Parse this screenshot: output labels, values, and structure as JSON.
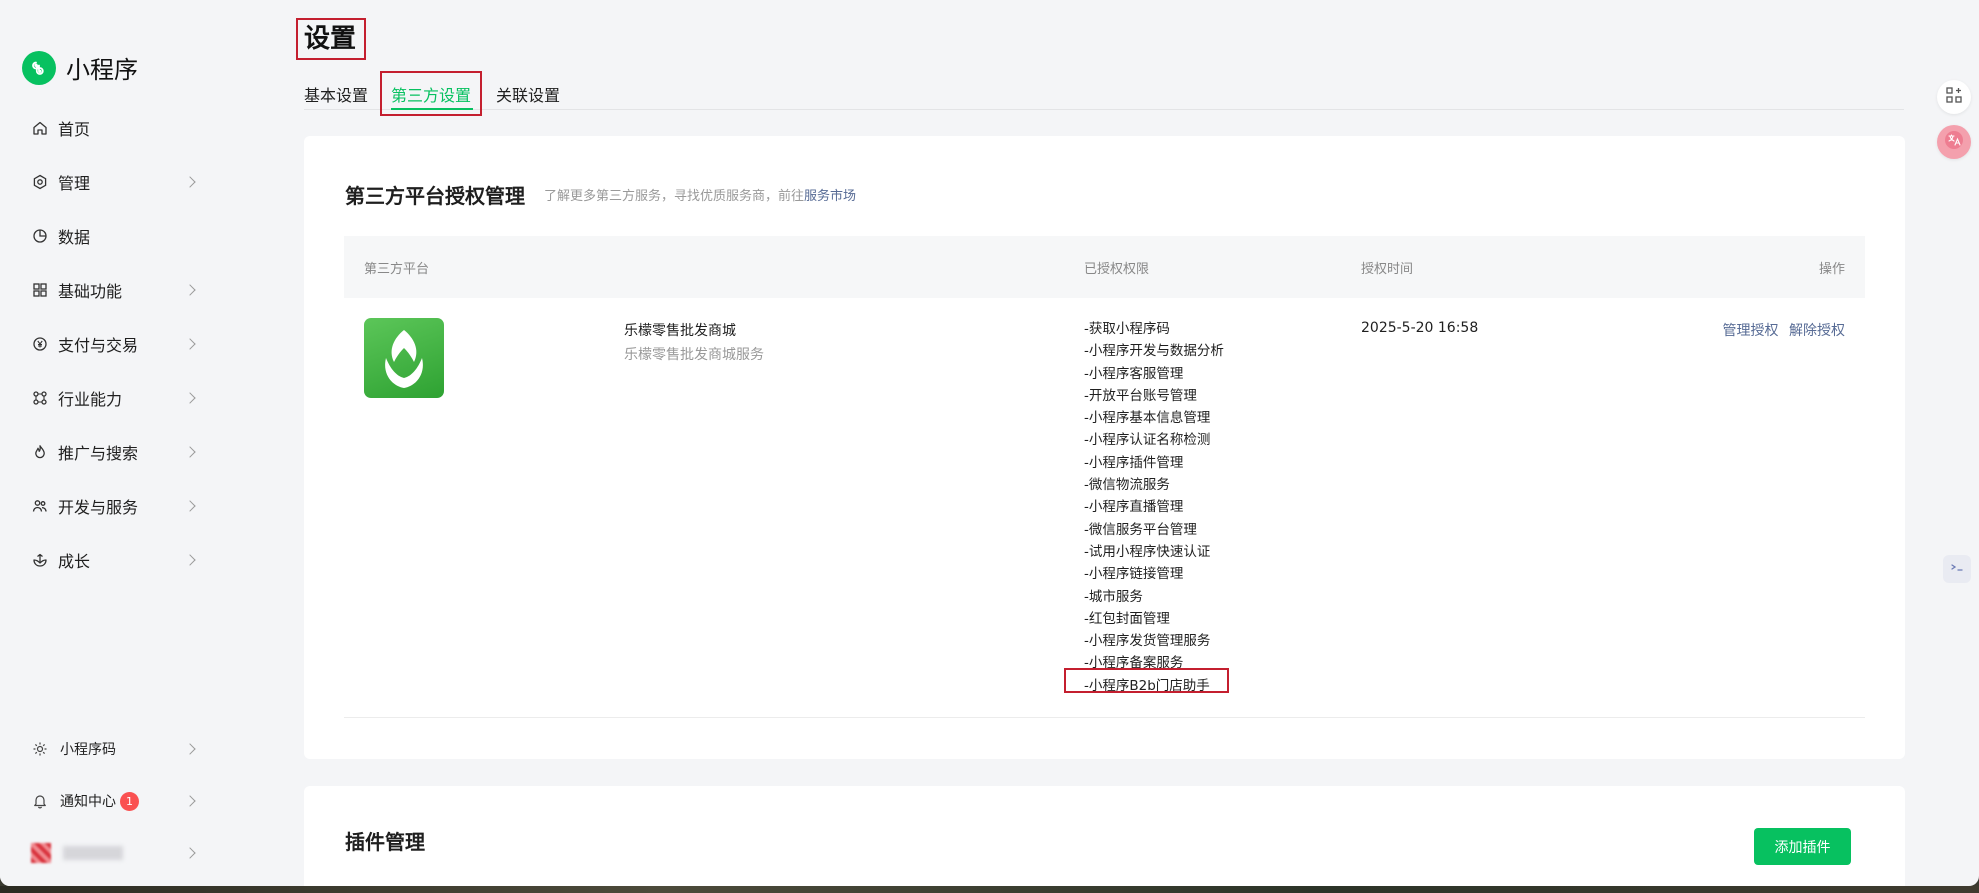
{
  "sidebar": {
    "app_name": "小程序",
    "items": [
      {
        "label": "首页"
      },
      {
        "label": "管理"
      },
      {
        "label": "数据"
      },
      {
        "label": "基础功能"
      },
      {
        "label": "支付与交易"
      },
      {
        "label": "行业能力"
      },
      {
        "label": "推广与搜索"
      },
      {
        "label": "开发与服务"
      },
      {
        "label": "成长"
      }
    ],
    "bottom": {
      "qrcode_label": "小程序码",
      "notify_label": "通知中心",
      "notify_count": "1"
    }
  },
  "page": {
    "title": "设置",
    "tabs": [
      "基本设置",
      "第三方设置",
      "关联设置"
    ]
  },
  "third_party": {
    "title": "第三方平台授权管理",
    "subtitle_prefix": "了解更多第三方服务，寻找优质服务商，前往",
    "subtitle_link": "服务市场",
    "columns": {
      "platform": "第三方平台",
      "permissions": "已授权权限",
      "time": "授权时间",
      "actions": "操作"
    },
    "row": {
      "name": "乐檬零售批发商城",
      "description": "乐檬零售批发商城服务",
      "permissions": [
        "-获取小程序码",
        "-小程序开发与数据分析",
        "-小程序客服管理",
        "-开放平台账号管理",
        "-小程序基本信息管理",
        "-小程序认证名称检测",
        "-小程序插件管理",
        "-微信物流服务",
        "-小程序直播管理",
        "-微信服务平台管理",
        "-试用小程序快速认证",
        "-小程序链接管理",
        "-城市服务",
        "-红包封面管理",
        "-小程序发货管理服务",
        "-小程序备案服务",
        "-小程序B2b门店助手"
      ],
      "auth_time": "2025-5-20 16:58",
      "action_manage": "管理授权",
      "action_revoke": "解除授权"
    }
  },
  "plugins": {
    "title": "插件管理",
    "add_button": "添加插件"
  },
  "colors": {
    "accent": "#07c160",
    "link": "#576b95",
    "highlight_box": "#c41f2f",
    "badge": "#fa5151"
  }
}
